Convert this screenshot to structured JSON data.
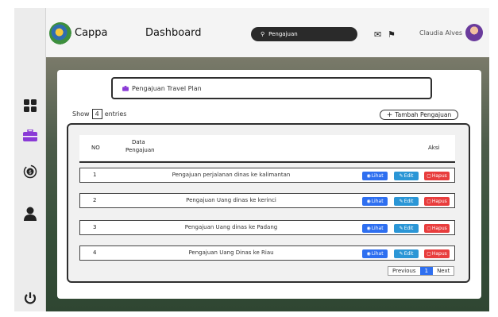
{
  "header": {
    "brand": "Cappa",
    "title": "Dashboard",
    "search_value": "Pengajuan",
    "user_name": "Claudia Alves"
  },
  "sidebar": {
    "items": [
      {
        "icon": "grid-icon"
      },
      {
        "icon": "briefcase-icon"
      },
      {
        "icon": "money-icon"
      },
      {
        "icon": "user-icon"
      },
      {
        "icon": "power-icon"
      }
    ]
  },
  "content": {
    "section_title": "Pengajuan Travel Plan",
    "show_label": "Show",
    "entries_value": "4",
    "entries_label": "entries",
    "add_button": "Tambah Pengajuan"
  },
  "table": {
    "headers": {
      "no": "NO",
      "data_line1": "Data",
      "data_line2": "Pengajuan",
      "aksi": "Aksi"
    },
    "rows": [
      {
        "no": "1",
        "nama": "Pengajuan perjalanan dinas ke kalimantan"
      },
      {
        "no": "2",
        "nama": "Pengajuan Uang dinas ke kerinci"
      },
      {
        "no": "3",
        "nama": "Pengajuan Uang dinas ke Padang"
      },
      {
        "no": "4",
        "nama": "Pengajuan Uang Dinas ke Riau"
      }
    ],
    "actions": {
      "lihat": "Lihat",
      "edit": "Edit",
      "hapus": "Hapus"
    }
  },
  "pagination": {
    "previous": "Previous",
    "current": "1",
    "next": "Next"
  },
  "colors": {
    "lihat": "#2e6ff0",
    "edit": "#2b96d6",
    "hapus": "#e83d3d",
    "briefcase": "#8a3ad6"
  }
}
